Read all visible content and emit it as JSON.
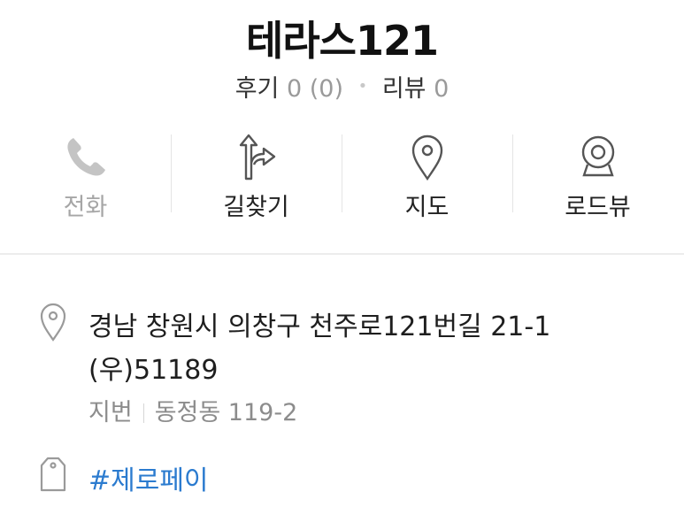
{
  "place": {
    "name": "테라스121",
    "reviews_label": "후기",
    "reviews_count": "0 (0)",
    "blog_label": "리뷰",
    "blog_count": "0"
  },
  "actions": [
    {
      "label": "전화",
      "icon": "phone-icon",
      "enabled": false
    },
    {
      "label": "길찾기",
      "icon": "directions-icon",
      "enabled": true
    },
    {
      "label": "지도",
      "icon": "map-pin-icon",
      "enabled": true
    },
    {
      "label": "로드뷰",
      "icon": "roadview-camera-icon",
      "enabled": true
    }
  ],
  "address": {
    "road": "경남 창원시 의창구 천주로121번길 21-1",
    "zip": "(우)51189",
    "jibun_label": "지번",
    "jibun_value": "동정동 119-2"
  },
  "tags": {
    "zeropay": "#제로페이"
  },
  "colors": {
    "link": "#2b7bcf",
    "disabled": "#a6a6a6",
    "icon": "#555555"
  }
}
